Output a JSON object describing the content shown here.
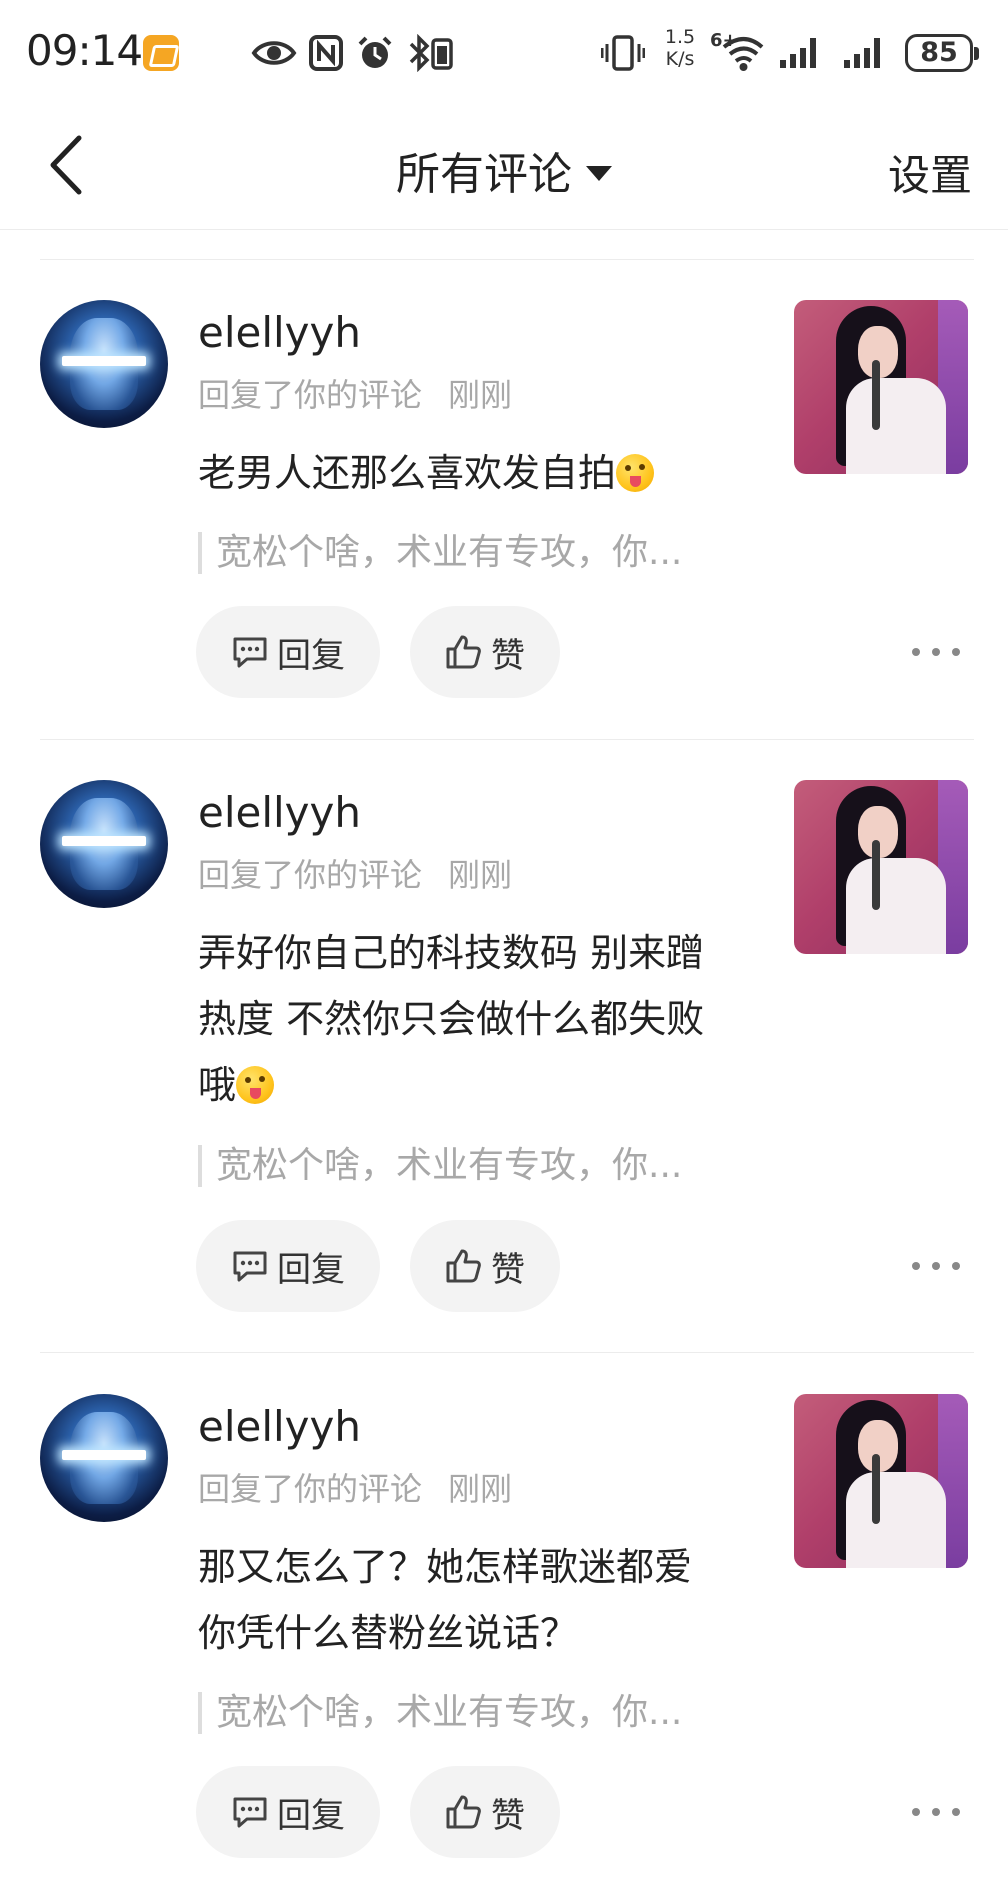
{
  "status_bar": {
    "time": "09:14",
    "network_speed_value": "1.5",
    "network_speed_unit": "K/s",
    "signal_label": "6+",
    "battery": "85",
    "icons": [
      "app-badge-icon",
      "eye-icon",
      "nfc-icon",
      "alarm-icon",
      "bluetooth-icon",
      "vibrate-icon",
      "wifi-icon",
      "signal-icon",
      "signal-icon"
    ]
  },
  "header": {
    "title": "所有评论",
    "settings_label": "设置"
  },
  "comments": [
    {
      "username": "elellyyh",
      "action": "回复了你的评论",
      "time_ago": "刚刚",
      "content": "老男人还那么喜欢发自拍",
      "quote": "宽松个啥，术业有专攻，你...",
      "reply_label": "回复",
      "like_label": "赞"
    },
    {
      "username": "elellyyh",
      "action": "回复了你的评论",
      "time_ago": "刚刚",
      "content": "弄好你自己的科技数码 别来蹭热度 不然你只会做什么都失败哦",
      "quote": "宽松个啥，术业有专攻，你...",
      "reply_label": "回复",
      "like_label": "赞"
    },
    {
      "username": "elellyyh",
      "action": "回复了你的评论",
      "time_ago": "刚刚",
      "content": "那又怎么了？她怎样歌迷都爱 你凭什么替粉丝说话？",
      "quote": "宽松个啥，术业有专攻，你...",
      "reply_label": "回复",
      "like_label": "赞"
    }
  ]
}
